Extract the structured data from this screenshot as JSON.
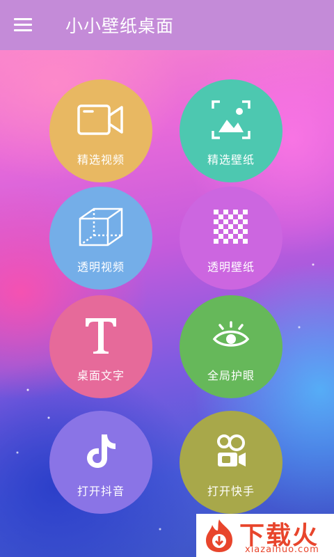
{
  "header": {
    "title": "小小壁纸桌面",
    "bg_color": "#c48bd8"
  },
  "tiles": [
    {
      "label": "精选视频",
      "icon": "video-camera-icon",
      "color": "#e8b862"
    },
    {
      "label": "精选壁纸",
      "icon": "image-frame-icon",
      "color": "#4dc8b0"
    },
    {
      "label": "透明视频",
      "icon": "cube-icon",
      "color": "#74aee8"
    },
    {
      "label": "透明壁纸",
      "icon": "checkerboard-icon",
      "color": "#cc66e0"
    },
    {
      "label": "桌面文字",
      "icon": "text-t-icon",
      "color": "#e66a9a"
    },
    {
      "label": "全局护眼",
      "icon": "eye-icon",
      "color": "#66b85a"
    },
    {
      "label": "打开抖音",
      "icon": "tiktok-icon",
      "color": "#8a74e6"
    },
    {
      "label": "打开快手",
      "icon": "kuaishou-icon",
      "color": "#a8a84a"
    }
  ],
  "watermark": {
    "title": "下载火",
    "site": "xiazaihuo.com",
    "color": "#e8452c"
  }
}
